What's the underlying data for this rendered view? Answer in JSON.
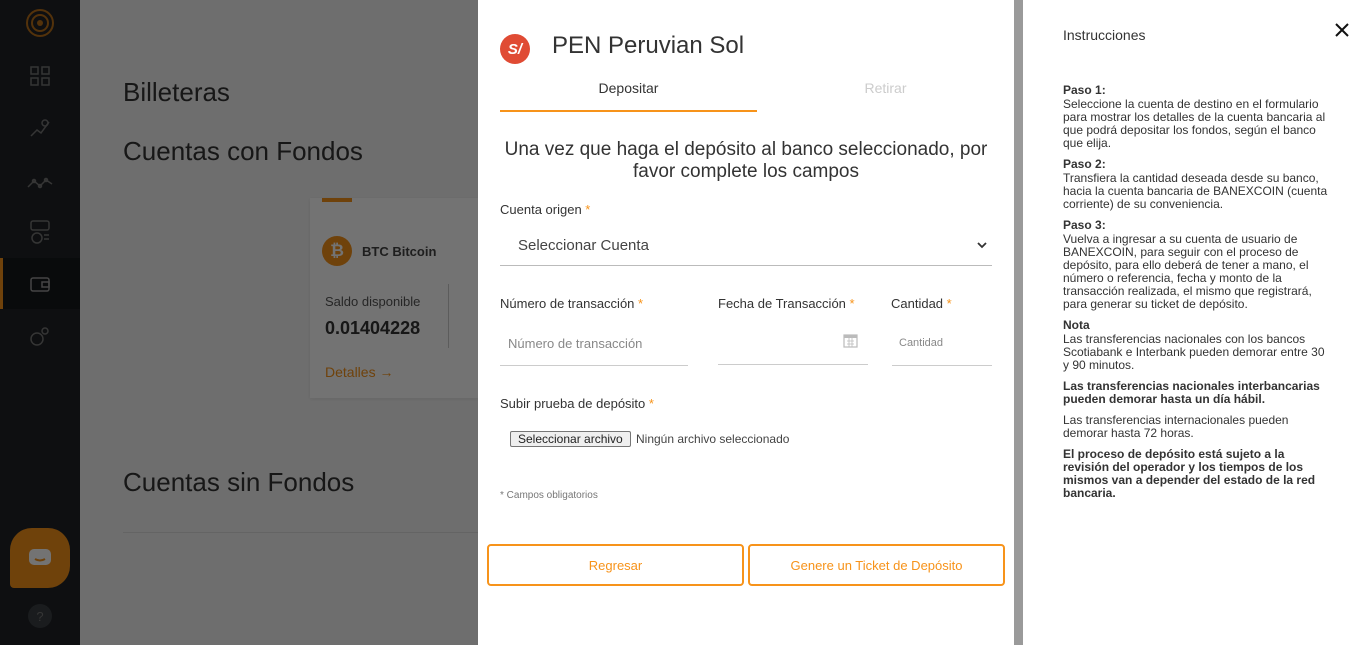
{
  "sidebar": {
    "items": [
      {
        "icon": "dashboard-icon"
      },
      {
        "icon": "exchange-icon"
      },
      {
        "icon": "chart-icon"
      },
      {
        "icon": "currency-exchange-icon"
      },
      {
        "icon": "wallet-icon"
      },
      {
        "icon": "settings-icon"
      }
    ],
    "help_label": "?"
  },
  "background": {
    "title": "Billeteras",
    "section_with_funds": "Cuentas con Fondos",
    "section_without_funds": "Cuentas sin Fondos",
    "card": {
      "currency_name": "BTC Bitcoin",
      "balance_label": "Saldo disponible",
      "balance_value": "0.01404228",
      "details_link": "Detalles  →"
    }
  },
  "modal": {
    "currency_logo": "S/",
    "title": "PEN Peruvian Sol",
    "tabs": [
      {
        "label": "Depositar",
        "active": true
      },
      {
        "label": "Retirar",
        "active": false
      }
    ],
    "intro": "Una vez que haga el depósito al banco seleccionado, por favor complete los campos",
    "source_account": {
      "label": "Cuenta origen",
      "selected": "Seleccionar Cuenta"
    },
    "transaction_number": {
      "label": "Número de transacción",
      "placeholder": "Número de transacción"
    },
    "transaction_date": {
      "label": "Fecha de Transacción",
      "placeholder": ""
    },
    "amount": {
      "label": "Cantidad",
      "placeholder": "Cantidad"
    },
    "upload": {
      "label": "Subir prueba de depósito",
      "button": "Seleccionar archivo",
      "file_status": "Ningún archivo seleccionado"
    },
    "required_marker": "*",
    "required_note": "* Campos obligatorios",
    "back_button": "Regresar",
    "submit_button": "Genere un Ticket de Depósito"
  },
  "instructions": {
    "title": "Instrucciones",
    "step1_title": "Paso 1:",
    "step1_text": "Seleccione la cuenta de destino en el formulario para mostrar los detalles de la cuenta bancaria al que podrá depositar los fondos, según el banco que elija.",
    "step2_title": "Paso 2:",
    "step2_text": "Transfiera la cantidad deseada desde su banco, hacia la cuenta bancaria de BANEXCOIN (cuenta corriente) de su conveniencia.",
    "step3_title": "Paso 3:",
    "step3_text": "Vuelva a ingresar a su cuenta de usuario de BANEXCOIN, para seguir con el proceso de depósito, para ello deberá de tener a mano, el número o referencia, fecha y monto de la transacción realizada, el mismo que registrará, para generar su ticket de depósito.",
    "note_title": "Nota",
    "note_text": "Las transferencias nacionales con los bancos Scotiabank e Interbank pueden demorar entre 30 y 90 minutos.",
    "note_bold1": "Las transferencias nacionales interbancarias pueden demorar hasta un día hábil.",
    "note_text2": "Las transferencias internacionales pueden demorar hasta 72 horas.",
    "note_bold2": "El proceso de depósito está sujeto a la revisión del operador y los tiempos de los mismos van a depender del estado de la red bancaria."
  },
  "colors": {
    "accent": "#f7931a",
    "sidebar": "#1f2326",
    "sol_logo": "#e04b34"
  }
}
